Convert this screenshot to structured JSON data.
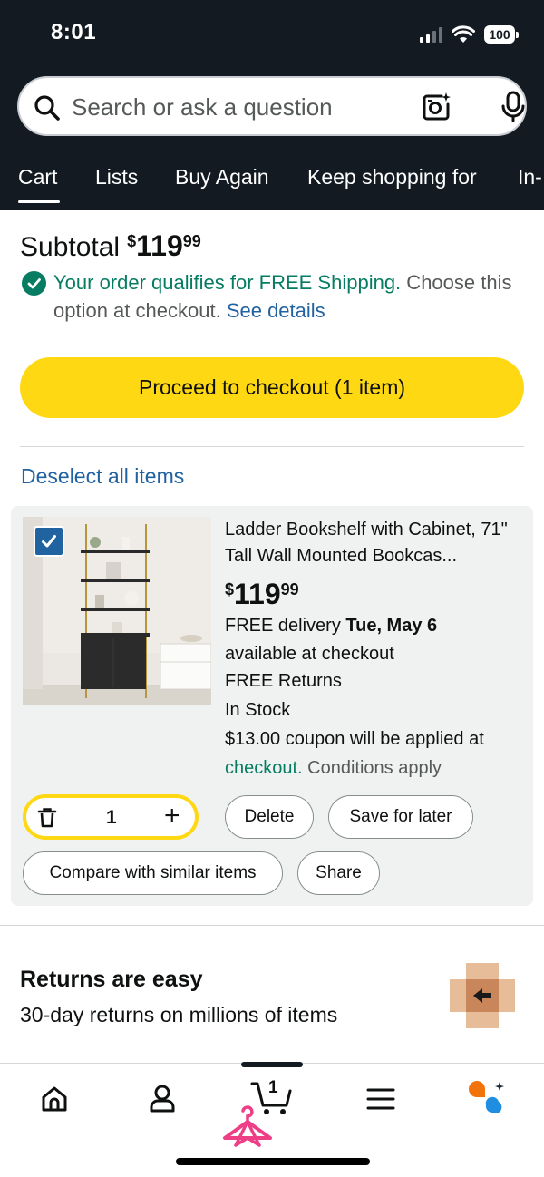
{
  "status_bar": {
    "time": "8:01",
    "battery": "100"
  },
  "search": {
    "placeholder": "Search or ask a question",
    "icons": [
      "search-icon",
      "camera-icon",
      "microphone-icon"
    ]
  },
  "nav_tabs": [
    {
      "label": "Cart",
      "active": true
    },
    {
      "label": "Lists"
    },
    {
      "label": "Buy Again"
    },
    {
      "label": "Keep shopping for"
    },
    {
      "label": "In-"
    }
  ],
  "subtotal": {
    "label": "Subtotal",
    "currency": "$",
    "whole": "119",
    "fraction": "99"
  },
  "shipping": {
    "qualifies_text": "Your order qualifies for FREE Shipping.",
    "rest_text": " Choose this option at checkout.",
    "link_text": "See details"
  },
  "checkout_button": "Proceed to checkout (1 item)",
  "deselect_link": "Deselect all items",
  "cart_item": {
    "checked": true,
    "title": "Ladder Bookshelf with Cabinet, 71\" Tall Wall Mounted Bookcas...",
    "price_currency": "$",
    "price_whole": "119",
    "price_fraction": "99",
    "delivery_prefix": "FREE delivery ",
    "delivery_date": "Tue, May 6",
    "delivery_suffix": "available at checkout",
    "returns": "FREE Returns",
    "stock": "In Stock",
    "coupon_line1": "$13.00 coupon will be applied at",
    "coupon_line2_green": "checkout.",
    "coupon_line2_grey": " Conditions apply",
    "quantity": "1",
    "plus_symbol": "+",
    "buttons": {
      "delete": "Delete",
      "save_for_later": "Save for later",
      "compare": "Compare with similar items",
      "share": "Share"
    }
  },
  "returns_banner": {
    "title": "Returns are easy",
    "subtitle": "30-day returns on millions of items"
  },
  "bottom_nav": {
    "items": [
      "home-icon",
      "account-icon",
      "cart-icon",
      "menu-icon",
      "rufus-assistant-icon"
    ],
    "cart_count": "1",
    "active": "cart-icon"
  },
  "colors": {
    "header_bg": "#131a22",
    "checkout_yellow": "#ffd814",
    "link_blue": "#2162a1",
    "success_green": "#067d62",
    "card_bg": "#f0f2f2"
  }
}
